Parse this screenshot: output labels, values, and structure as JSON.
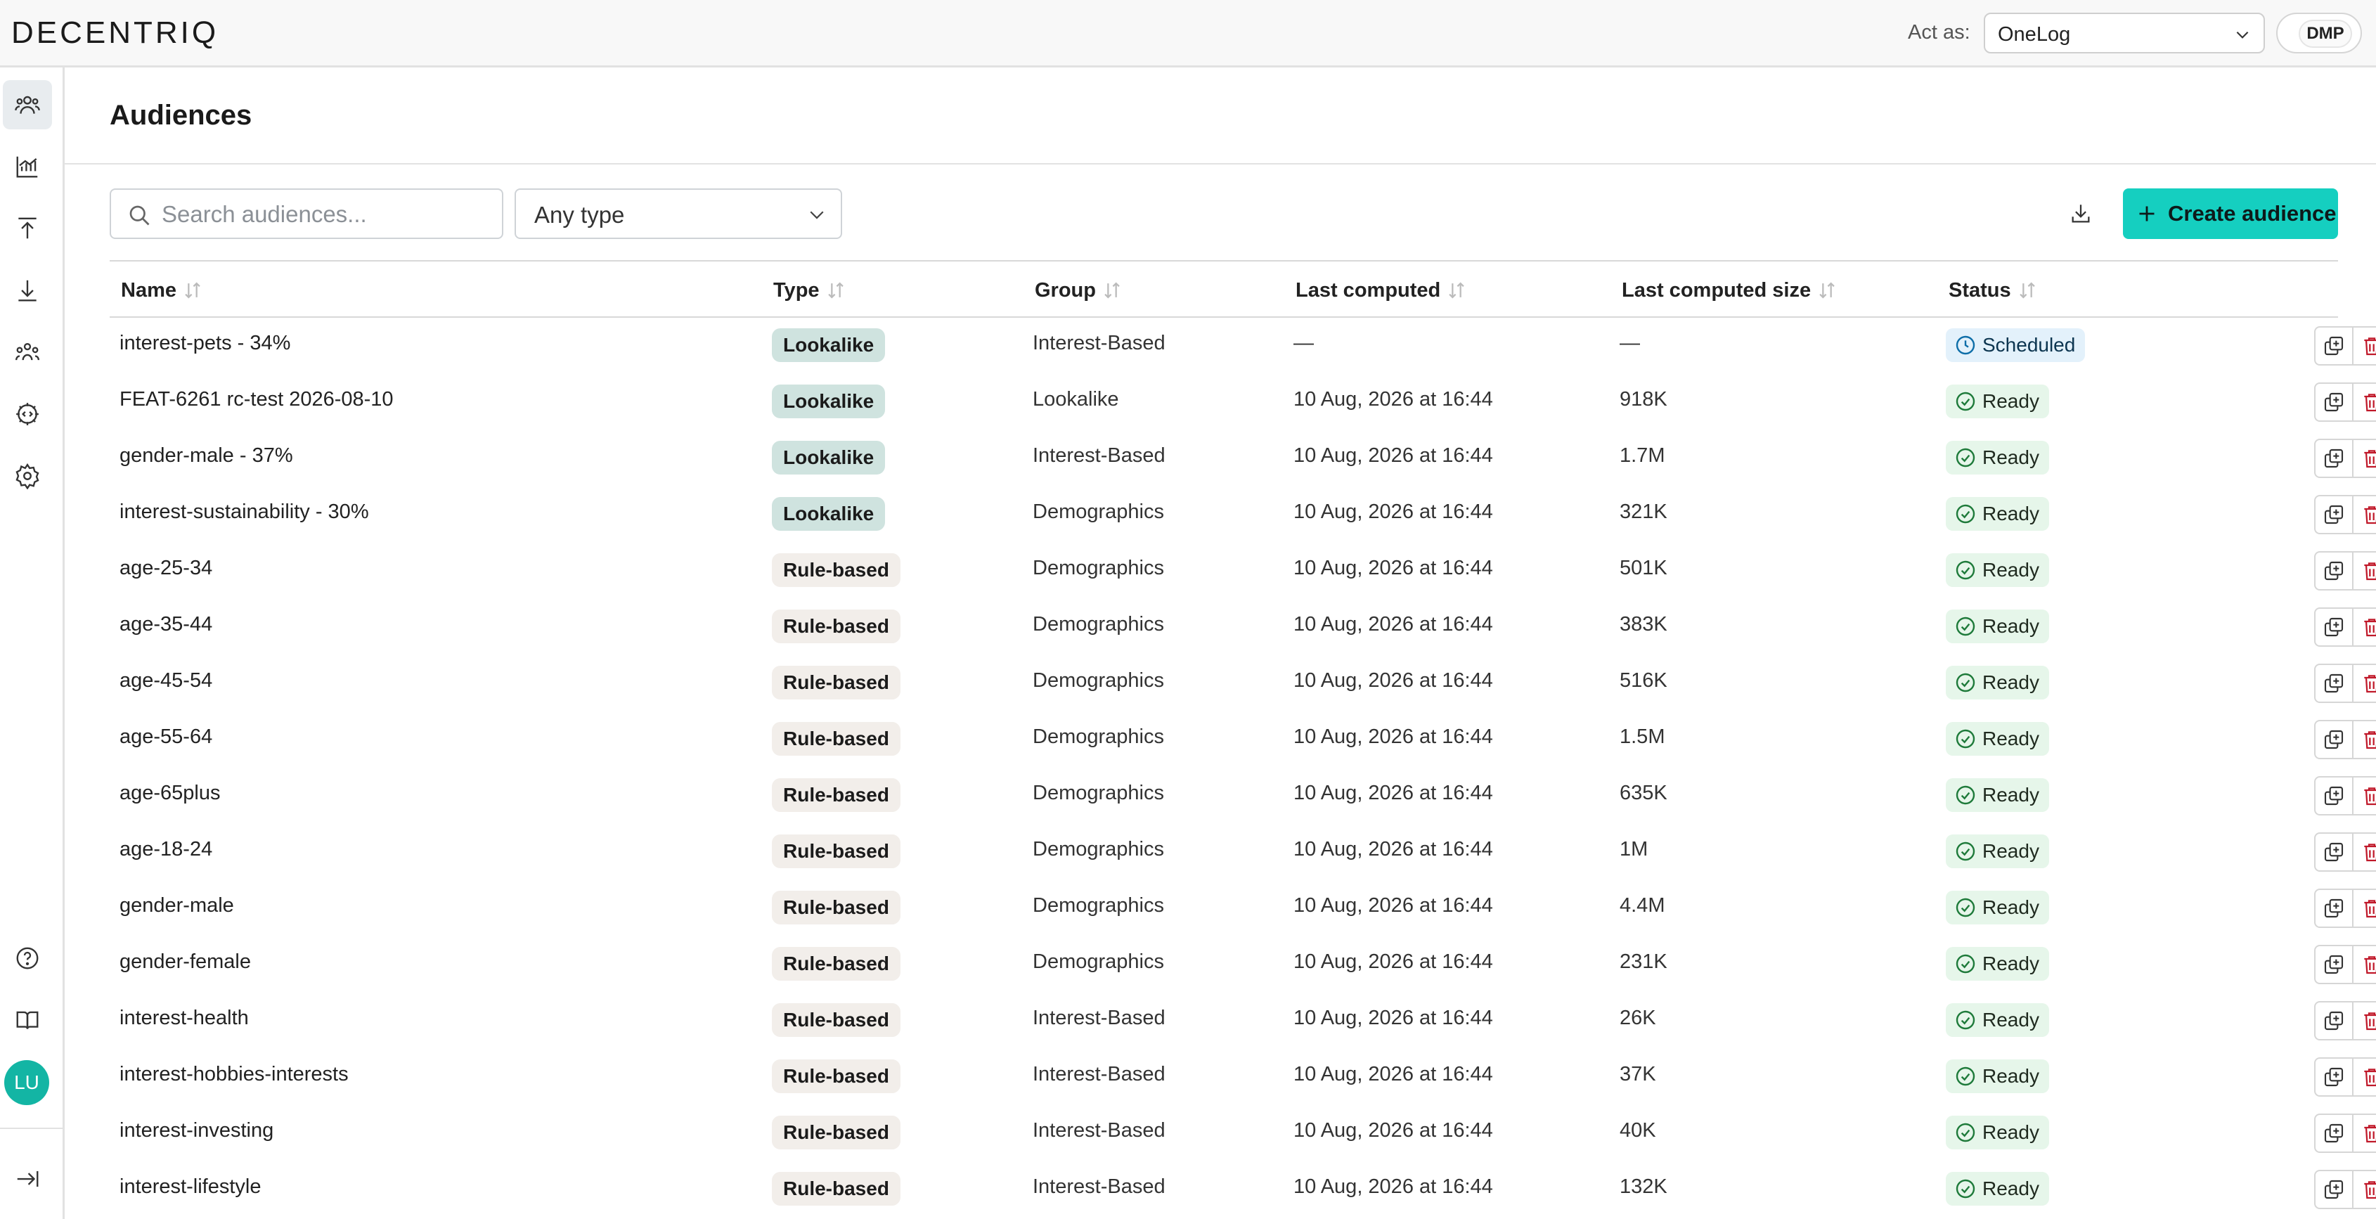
{
  "app": {
    "logo": "DECENTRIQ",
    "act_as_label": "Act as:",
    "act_as_value": "OneLog",
    "dmp_label": "DMP",
    "avatar_initials": "LU",
    "accent_color": "#15cfc0"
  },
  "sidebar": {
    "items": [
      {
        "icon": "audiences-icon",
        "active": true
      },
      {
        "icon": "insights-chart-icon",
        "active": false
      },
      {
        "icon": "publish-upload-icon",
        "active": false
      },
      {
        "icon": "download-icon",
        "active": false
      },
      {
        "icon": "users-group-icon",
        "active": false
      },
      {
        "icon": "api-gear-icon",
        "active": false
      },
      {
        "icon": "settings-gear-icon",
        "active": false
      }
    ],
    "bottom": [
      {
        "icon": "help-icon"
      },
      {
        "icon": "docs-book-icon"
      },
      {
        "icon": "collapse-sidebar-icon"
      }
    ]
  },
  "page": {
    "title": "Audiences",
    "search_placeholder": "Search audiences...",
    "type_filter": "Any type",
    "create_label": "Create audience"
  },
  "table": {
    "columns": [
      "Name",
      "Type",
      "Group",
      "Last computed",
      "Last computed size",
      "Status"
    ],
    "rows": [
      {
        "name": "interest-pets - 34%",
        "type": "Lookalike",
        "group": "Interest-Based",
        "last_computed": "—",
        "size": "—",
        "status": "Scheduled"
      },
      {
        "name": "FEAT-6261 rc-test 2026-08-10",
        "type": "Lookalike",
        "group": "Lookalike",
        "last_computed": "10 Aug, 2026 at 16:44",
        "size": "918K",
        "status": "Ready"
      },
      {
        "name": "gender-male - 37%",
        "type": "Lookalike",
        "group": "Interest-Based",
        "last_computed": "10 Aug, 2026 at 16:44",
        "size": "1.7M",
        "status": "Ready"
      },
      {
        "name": "interest-sustainability - 30%",
        "type": "Lookalike",
        "group": "Demographics",
        "last_computed": "10 Aug, 2026 at 16:44",
        "size": "321K",
        "status": "Ready"
      },
      {
        "name": "age-25-34",
        "type": "Rule-based",
        "group": "Demographics",
        "last_computed": "10 Aug, 2026 at 16:44",
        "size": "501K",
        "status": "Ready"
      },
      {
        "name": "age-35-44",
        "type": "Rule-based",
        "group": "Demographics",
        "last_computed": "10 Aug, 2026 at 16:44",
        "size": "383K",
        "status": "Ready"
      },
      {
        "name": "age-45-54",
        "type": "Rule-based",
        "group": "Demographics",
        "last_computed": "10 Aug, 2026 at 16:44",
        "size": "516K",
        "status": "Ready"
      },
      {
        "name": "age-55-64",
        "type": "Rule-based",
        "group": "Demographics",
        "last_computed": "10 Aug, 2026 at 16:44",
        "size": "1.5M",
        "status": "Ready"
      },
      {
        "name": "age-65plus",
        "type": "Rule-based",
        "group": "Demographics",
        "last_computed": "10 Aug, 2026 at 16:44",
        "size": "635K",
        "status": "Ready"
      },
      {
        "name": "age-18-24",
        "type": "Rule-based",
        "group": "Demographics",
        "last_computed": "10 Aug, 2026 at 16:44",
        "size": "1M",
        "status": "Ready"
      },
      {
        "name": "gender-male",
        "type": "Rule-based",
        "group": "Demographics",
        "last_computed": "10 Aug, 2026 at 16:44",
        "size": "4.4M",
        "status": "Ready"
      },
      {
        "name": "gender-female",
        "type": "Rule-based",
        "group": "Demographics",
        "last_computed": "10 Aug, 2026 at 16:44",
        "size": "231K",
        "status": "Ready"
      },
      {
        "name": "interest-health",
        "type": "Rule-based",
        "group": "Interest-Based",
        "last_computed": "10 Aug, 2026 at 16:44",
        "size": "26K",
        "status": "Ready"
      },
      {
        "name": "interest-hobbies-interests",
        "type": "Rule-based",
        "group": "Interest-Based",
        "last_computed": "10 Aug, 2026 at 16:44",
        "size": "37K",
        "status": "Ready"
      },
      {
        "name": "interest-investing",
        "type": "Rule-based",
        "group": "Interest-Based",
        "last_computed": "10 Aug, 2026 at 16:44",
        "size": "40K",
        "status": "Ready"
      },
      {
        "name": "interest-lifestyle",
        "type": "Rule-based",
        "group": "Interest-Based",
        "last_computed": "10 Aug, 2026 at 16:44",
        "size": "132K",
        "status": "Ready"
      }
    ]
  }
}
